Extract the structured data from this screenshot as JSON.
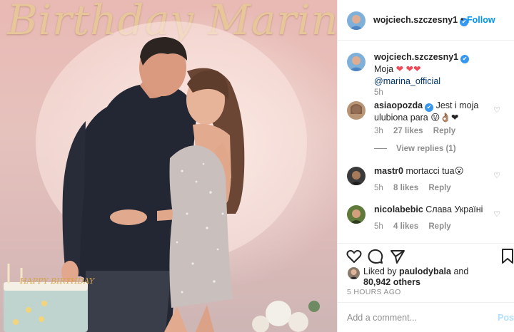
{
  "photo": {
    "banner_text": "Birthday Marina",
    "cake_text": "HAPPY BIRTHDAY"
  },
  "header": {
    "username": "wojciech.szczesny1",
    "verified_mark": "✔",
    "separator": "•",
    "follow_label": "Follow"
  },
  "caption": {
    "username": "wojciech.szczesny1",
    "text": "Moja",
    "hearts_a": "❤",
    "hearts_b": "❤❤",
    "mention": "@marina_official",
    "time": "5h"
  },
  "comments": [
    {
      "username": "asiaopozda",
      "text": "Jest i moja ulubiona para 😛👌🏽❤",
      "time": "3h",
      "likes": "27 likes",
      "reply_label": "Reply",
      "view_replies": "View replies (1)"
    },
    {
      "username": "mastr0",
      "text": "mortacci tua😮",
      "time": "5h",
      "likes": "8 likes",
      "reply_label": "Reply"
    },
    {
      "username": "nicolabebic",
      "text": "Слава Україні",
      "time": "5h",
      "likes": "4 likes",
      "reply_label": "Reply"
    }
  ],
  "likes_summary": {
    "prefix": "Liked by",
    "user": "paulodybala",
    "connector": "and",
    "count": "80,942 others"
  },
  "posted_ago": "5 HOURS AGO",
  "composer": {
    "placeholder": "Add a comment...",
    "post_label": "Post"
  },
  "icons": {
    "heart": "heart-icon",
    "comment": "comment-icon",
    "share": "share-icon",
    "save": "bookmark-icon"
  },
  "colors": {
    "accent_blue": "#0095f6",
    "verified_blue": "#3897f0",
    "muted": "#8e8e8e",
    "link": "#00376b",
    "heart_red": "#ed4956"
  }
}
